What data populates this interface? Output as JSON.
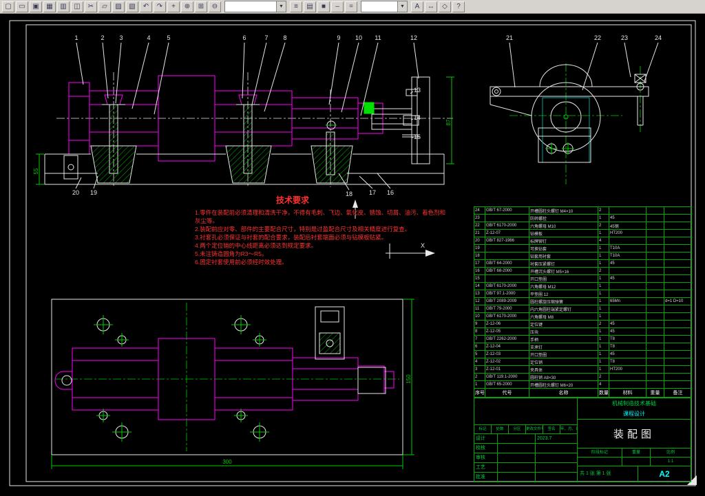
{
  "toolbar": {
    "icons1": [
      {
        "name": "new-icon",
        "glyph": "▢"
      },
      {
        "name": "open-icon",
        "glyph": "▭"
      },
      {
        "name": "save-icon",
        "glyph": "▣"
      },
      {
        "name": "plot-icon",
        "glyph": "▦"
      },
      {
        "name": "plot-preview-icon",
        "glyph": "▥"
      },
      {
        "name": "publish-icon",
        "glyph": "◫"
      },
      {
        "name": "cut-icon",
        "glyph": "✂"
      },
      {
        "name": "copy-icon",
        "glyph": "▱"
      },
      {
        "name": "paste-icon",
        "glyph": "▨"
      },
      {
        "name": "match-properties-icon",
        "glyph": "▧"
      },
      {
        "name": "undo-icon",
        "glyph": "↶"
      },
      {
        "name": "redo-icon",
        "glyph": "↷"
      },
      {
        "name": "pan-icon",
        "glyph": "+"
      },
      {
        "name": "zoom-realtime-icon",
        "glyph": "⊕"
      },
      {
        "name": "zoom-window-icon",
        "glyph": "⊞"
      },
      {
        "name": "zoom-previous-icon",
        "glyph": "⊖"
      }
    ],
    "icons2": [
      {
        "name": "layers-icon",
        "glyph": "≡"
      },
      {
        "name": "layer-properties-icon",
        "glyph": "▤"
      },
      {
        "name": "color-control-icon",
        "glyph": "■"
      },
      {
        "name": "linetype-icon",
        "glyph": "–"
      },
      {
        "name": "lineweight-icon",
        "glyph": "="
      }
    ],
    "icons3": [
      {
        "name": "text-icon",
        "glyph": "A"
      },
      {
        "name": "dimension-icon",
        "glyph": "↔"
      },
      {
        "name": "osnap-icon",
        "glyph": "◇"
      },
      {
        "name": "help-icon",
        "glyph": "?"
      }
    ],
    "dropdown_glyph": "▼"
  },
  "drawing": {
    "callouts": [
      "1",
      "2",
      "3",
      "4",
      "5",
      "6",
      "7",
      "8",
      "9",
      "10",
      "11",
      "12",
      "13",
      "14",
      "15",
      "16",
      "17",
      "18",
      "19",
      "20",
      "21",
      "22",
      "23",
      "24"
    ],
    "dims": {
      "plan_width": "300",
      "plan_height": "150",
      "front_height": "87",
      "base_height": "55"
    },
    "ucs_label": "X"
  },
  "tech": {
    "title": "技术要求",
    "lines": [
      "1.零件在装配前必须清理和清洗干净，不得有毛刺、飞边、氧化皮、锈蚀、切屑、油污、着色剂和灰尘等。",
      "2.装配前应对零、部件的主要配合尺寸，特别是过盈配合尺寸及相关精度进行复查。",
      "3.衬套孔必须保证与衬套的配合要求，装配后衬套端面必须与钻模板贴紧。",
      "4.两个定位销的中心线距离必须达到规定要求。",
      "5.未注铸造圆角为R3～R5。",
      "6.固定衬套使用前必须经时效处理。"
    ]
  },
  "bom": {
    "headers": [
      "序号",
      "代号",
      "名称",
      "数量",
      "材料",
      "重量",
      "备注"
    ],
    "rows": [
      {
        "no": "24",
        "code": "GB/T 67-2000",
        "name": "开槽圆柱头螺钉 M4×10",
        "qty": "2",
        "mat": "",
        "note": ""
      },
      {
        "no": "23",
        "code": "",
        "name": "防转螺栓",
        "qty": "1",
        "mat": "45",
        "note": ""
      },
      {
        "no": "22",
        "code": "GB/T 6170-2000",
        "name": "六角螺母 M10",
        "qty": "2",
        "mat": "45钢",
        "note": ""
      },
      {
        "no": "21",
        "code": "Z-12-07",
        "name": "钻模板",
        "qty": "1",
        "mat": "HT200",
        "note": ""
      },
      {
        "no": "20",
        "code": "GB/T 827-1986",
        "name": "标牌铆钉",
        "qty": "4",
        "mat": "",
        "note": ""
      },
      {
        "no": "19",
        "code": "",
        "name": "可换钻套",
        "qty": "1",
        "mat": "T10A",
        "note": ""
      },
      {
        "no": "18",
        "code": "",
        "name": "钻套用衬套",
        "qty": "1",
        "mat": "T10A",
        "note": ""
      },
      {
        "no": "17",
        "code": "GB/T 64-2000",
        "name": "衬套压紧螺钉",
        "qty": "1",
        "mat": "45",
        "note": ""
      },
      {
        "no": "16",
        "code": "GB/T 68-2000",
        "name": "开槽沉头螺钉 M5×16",
        "qty": "2",
        "mat": "",
        "note": ""
      },
      {
        "no": "15",
        "code": "",
        "name": "开口垫圈",
        "qty": "1",
        "mat": "45",
        "note": ""
      },
      {
        "no": "14",
        "code": "GB/T 6170-2000",
        "name": "六角螺母 M12",
        "qty": "1",
        "mat": "",
        "note": ""
      },
      {
        "no": "13",
        "code": "GB/T 97.1-2000",
        "name": "平垫圈 12",
        "qty": "1",
        "mat": "",
        "note": ""
      },
      {
        "no": "12",
        "code": "GB/T 2089-2009",
        "name": "圆柱螺旋压缩弹簧",
        "qty": "1",
        "mat": "65Mn",
        "note": "d=1 D=10"
      },
      {
        "no": "11",
        "code": "GB/T 79-2000",
        "name": "内六角圆柱端紧定螺钉",
        "qty": "1",
        "mat": "",
        "note": ""
      },
      {
        "no": "10",
        "code": "GB/T 6170-2000",
        "name": "六角螺母 M8",
        "qty": "1",
        "mat": "",
        "note": ""
      },
      {
        "no": "9",
        "code": "Z-12-06",
        "name": "定位键",
        "qty": "2",
        "mat": "45",
        "note": ""
      },
      {
        "no": "8",
        "code": "Z-12-05",
        "name": "压块",
        "qty": "1",
        "mat": "45",
        "note": ""
      },
      {
        "no": "7",
        "code": "GB/T 2262-2000",
        "name": "手柄",
        "qty": "1",
        "mat": "T8",
        "note": ""
      },
      {
        "no": "6",
        "code": "Z-12-04",
        "name": "支承钉",
        "qty": "1",
        "mat": "T8",
        "note": ""
      },
      {
        "no": "5",
        "code": "Z-12-03",
        "name": "开口垫圈",
        "qty": "1",
        "mat": "45",
        "note": ""
      },
      {
        "no": "4",
        "code": "Z-12-02",
        "name": "定位销",
        "qty": "1",
        "mat": "T8",
        "note": ""
      },
      {
        "no": "3",
        "code": "Z-12-01",
        "name": "夹具体",
        "qty": "1",
        "mat": "HT200",
        "note": ""
      },
      {
        "no": "2",
        "code": "GB/T 119.1-2000",
        "name": "圆柱销 A8×30",
        "qty": "2",
        "mat": "",
        "note": ""
      },
      {
        "no": "1",
        "code": "GB/T 65-2000",
        "name": "开槽圆柱头螺钉 M6×20",
        "qty": "4",
        "mat": "",
        "note": ""
      }
    ]
  },
  "title_block": {
    "org_line1": "机械制造技术基础",
    "org_line2": "课程设计",
    "drawing_title": "装配图",
    "sheet_size": "A2",
    "scale_value": "1:1",
    "labels": {
      "stage": "阶段标记",
      "weight": "重量",
      "scale": "比例",
      "sheets": "共 1 张 第 1 张"
    },
    "sign_headers": [
      "标记",
      "处数",
      "分区",
      "更改文件号",
      "签名",
      "年、月、日"
    ],
    "sign_rows": [
      {
        "role": "设计",
        "name": "",
        "date": "2023.7"
      },
      {
        "role": "校核",
        "name": "",
        "date": ""
      },
      {
        "role": "审核",
        "name": "",
        "date": ""
      },
      {
        "role": "工艺",
        "name": "",
        "date": ""
      },
      {
        "role": "批准",
        "name": "",
        "date": ""
      }
    ]
  }
}
